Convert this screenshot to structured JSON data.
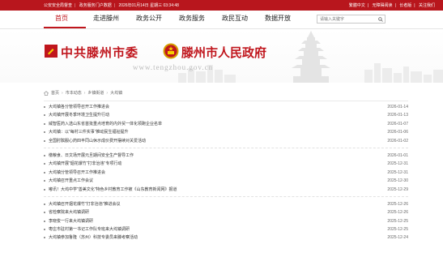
{
  "topbar": {
    "left_items": [
      "公安安全局督查",
      "政务服务门户数据",
      "2026年01月14日 星期三 03:34:48"
    ],
    "right_items": [
      "繁體中文",
      "无障碍阅读",
      "长者版",
      "关注我们"
    ]
  },
  "nav": {
    "items": [
      "首页",
      "走进滕州",
      "政务公开",
      "政务服务",
      "政民互动",
      "数据开放"
    ],
    "active_index": 0
  },
  "search": {
    "placeholder": "请输入关键字"
  },
  "banner": {
    "title_party": "中共滕州市委",
    "title_gov": "滕州市人民政府",
    "url": "www.tengzhou.gov.cn",
    "brand_color": "#c0161d"
  },
  "breadcrumb": [
    "首页",
    "市本动态",
    "乡镇街道",
    "大坞镇"
  ],
  "news_groups": [
    [
      {
        "title": "大坞镇各分管领导召开工作推进会",
        "date": "2026-01-14"
      },
      {
        "title": "大坞镇开展冬季环境卫生提升行动",
        "date": "2026-01-13"
      },
      {
        "title": "威智医药入选山东省首批重点培育的内外贸一体化领跑企业名单",
        "date": "2026-01-07"
      },
      {
        "title": "大坞镇：以\"每村三件实事\"推动民生福祉提升",
        "date": "2026-01-06"
      },
      {
        "title": "全国肘髌服心药四丰同山休示成价费开摆续对关爱活动",
        "date": "2026-01-02"
      }
    ],
    [
      {
        "title": "缴粮食、日文场开展元旦期间安全生产督导工作",
        "date": "2026-01-01"
      },
      {
        "title": "大坞镇开展\"烟花爆竹\"打非治违\"专项行动",
        "date": "2025-12-31"
      },
      {
        "title": "大坞镇分管领导召开工作推进会",
        "date": "2025-12-31"
      },
      {
        "title": "大坞镇召开重点工作会议",
        "date": "2025-12-30"
      },
      {
        "title": "嘟讯！大坞中学\"善美文化\"特色乡村教育工作被《山东教育新闻网》报道",
        "date": "2025-12-29"
      }
    ],
    [
      {
        "title": "大坞镇召开烟花爆竹\"打非治违\"推进会议",
        "date": "2025-12-26"
      },
      {
        "title": "省检察院来大坞镇调研",
        "date": "2025-12-26"
      },
      {
        "title": "李晓俊一行来大坞镇调研",
        "date": "2025-12-25"
      },
      {
        "title": "枣庄市驻村第一书记工作队专班来大坞镇调研",
        "date": "2025-12-25"
      },
      {
        "title": "大坞镇参加鲁隆（苏州）科技专委员来滕考察活动",
        "date": "2025-12-24"
      }
    ]
  ]
}
